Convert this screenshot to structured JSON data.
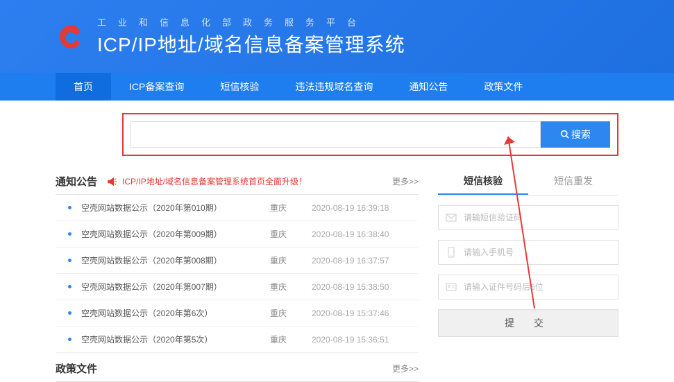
{
  "header": {
    "subtitle": "工业和信息化部政务服务平台",
    "title": "ICP/IP地址/域名信息备案管理系统"
  },
  "nav": {
    "items": [
      {
        "label": "首页",
        "active": true
      },
      {
        "label": "ICP备案查询",
        "active": false
      },
      {
        "label": "短信核验",
        "active": false
      },
      {
        "label": "违法违规域名查询",
        "active": false
      },
      {
        "label": "通知公告",
        "active": false
      },
      {
        "label": "政策文件",
        "active": false
      }
    ]
  },
  "search": {
    "value": "",
    "button": "搜索"
  },
  "notice": {
    "heading": "通知公告",
    "banner": "ICP/IP地址/域名信息备案管理系统首页全面升级！",
    "more": "更多>>",
    "rows": [
      {
        "title": "空壳网站数据公示（2020年第010期）",
        "loc": "重庆",
        "date": "2020-08-19 16:39:18"
      },
      {
        "title": "空壳网站数据公示（2020年第009期）",
        "loc": "重庆",
        "date": "2020-08-19 16:38:40"
      },
      {
        "title": "空壳网站数据公示（2020年第008期）",
        "loc": "重庆",
        "date": "2020-08-19 16:37:57"
      },
      {
        "title": "空壳网站数据公示（2020年第007期）",
        "loc": "重庆",
        "date": "2020-08-19 15:38:50"
      },
      {
        "title": "空壳网站数据公示（2020年第6次）",
        "loc": "重庆",
        "date": "2020-08-19 15:37:46"
      },
      {
        "title": "空壳网站数据公示（2020年第5次）",
        "loc": "重庆",
        "date": "2020-08-19 15:36:51"
      }
    ]
  },
  "policy": {
    "heading": "政策文件",
    "more": "更多>>"
  },
  "sms": {
    "tabs": [
      {
        "label": "短信核验",
        "active": true
      },
      {
        "label": "短信重发",
        "active": false
      }
    ],
    "code_placeholder": "请输短信验证码",
    "phone_placeholder": "请输入手机号",
    "id_placeholder": "请输入证件号码后6位",
    "submit": "提 交"
  }
}
